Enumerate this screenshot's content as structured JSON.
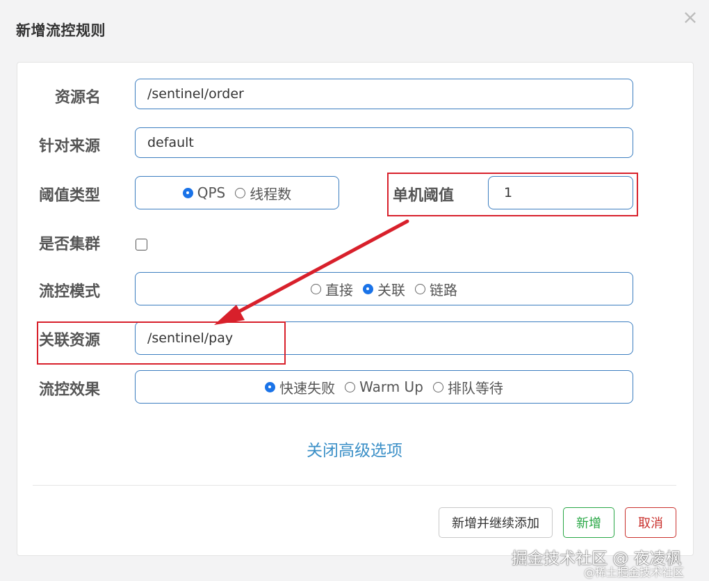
{
  "dialog": {
    "title": "新增流控规则",
    "close_symbol": "×"
  },
  "form": {
    "resource_label": "资源名",
    "resource_value": "/sentinel/order",
    "origin_label": "针对来源",
    "origin_value": "default",
    "threshold_type_label": "阈值类型",
    "threshold_type_options": [
      {
        "label": "QPS",
        "checked": true
      },
      {
        "label": "线程数",
        "checked": false
      }
    ],
    "single_threshold_label": "单机阈值",
    "single_threshold_value": "1",
    "cluster_label": "是否集群",
    "cluster_checked": false,
    "mode_label": "流控模式",
    "mode_options": [
      {
        "label": "直接",
        "checked": false
      },
      {
        "label": "关联",
        "checked": true
      },
      {
        "label": "链路",
        "checked": false
      }
    ],
    "ref_resource_label": "关联资源",
    "ref_resource_value": "/sentinel/pay",
    "effect_label": "流控效果",
    "effect_options": [
      {
        "label": "快速失败",
        "checked": true
      },
      {
        "label": "Warm Up",
        "checked": false
      },
      {
        "label": "排队等待",
        "checked": false
      }
    ],
    "advanced_link": "关闭高级选项"
  },
  "buttons": {
    "continue_label": "新增并继续添加",
    "add_label": "新增",
    "cancel_label": "取消"
  },
  "annotation": {
    "highlight_color": "#d8202b"
  },
  "watermark": {
    "main": "掘金技术社区 @ 夜凌枫",
    "sub": "@稀土掘金技术社区"
  },
  "colors": {
    "input_border": "#3c7ec0",
    "radio_checked": "#1a73e8",
    "link": "#3a8fc7",
    "add_button": "#28a745",
    "cancel_button": "#c9302c"
  }
}
